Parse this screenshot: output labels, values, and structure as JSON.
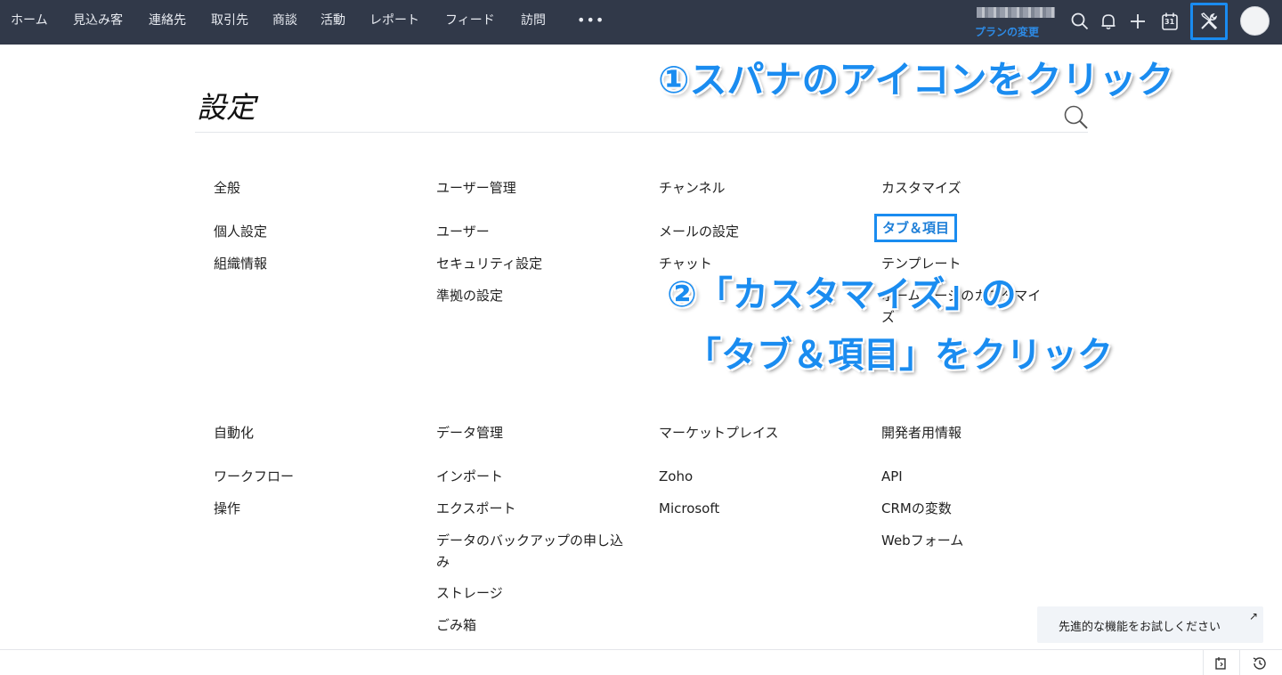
{
  "nav": {
    "items": [
      "ホーム",
      "見込み客",
      "連絡先",
      "取引先",
      "商談",
      "活動",
      "レポート",
      "フィード",
      "訪問"
    ],
    "more_label": "•••"
  },
  "header": {
    "plan_link": "プランの変更"
  },
  "page": {
    "title": "設定"
  },
  "columns": [
    {
      "sections": [
        {
          "heading": "全般",
          "links": [
            "個人設定",
            "組織情報"
          ]
        },
        {
          "heading": "自動化",
          "links": [
            "ワークフロー",
            "操作"
          ]
        }
      ]
    },
    {
      "sections": [
        {
          "heading": "ユーザー管理",
          "links": [
            "ユーザー",
            "セキュリティ設定",
            "準拠の設定"
          ]
        },
        {
          "heading": "データ管理",
          "links": [
            "インポート",
            "エクスポート",
            "データのバックアップの申し込み",
            "ストレージ",
            "ごみ箱"
          ]
        }
      ]
    },
    {
      "sections": [
        {
          "heading": "チャンネル",
          "links": [
            "メールの設定",
            "チャット"
          ]
        },
        {
          "heading": "マーケットプレイス",
          "links": [
            "Zoho",
            "Microsoft"
          ]
        }
      ]
    },
    {
      "sections": [
        {
          "heading": "カスタマイズ",
          "links": [
            "タブ＆項目",
            "テンプレート",
            "ホームページのカスタマイズ"
          ]
        },
        {
          "heading": "開発者用情報",
          "links": [
            "API",
            "CRMの変数",
            "Webフォーム"
          ]
        }
      ]
    }
  ],
  "annotations": {
    "step1": "①スパナのアイコンをクリック",
    "step2_line1": "②「カスタマイズ」の",
    "step2_line2": "「タブ＆項目」をクリック"
  },
  "trial_banner": {
    "text": "先進的な機能をお試しください",
    "arrow": "↗"
  },
  "icons": {
    "search": "search-icon",
    "bell": "bell-icon",
    "plus": "plus-icon",
    "calendar": "calendar-icon",
    "setup": "wrench-screwdriver-icon",
    "avatar": "avatar",
    "calendar_day": "31"
  },
  "colors": {
    "topbar": "#313949",
    "accent": "#1a8cf0",
    "link_blue": "#1e7fd8"
  }
}
